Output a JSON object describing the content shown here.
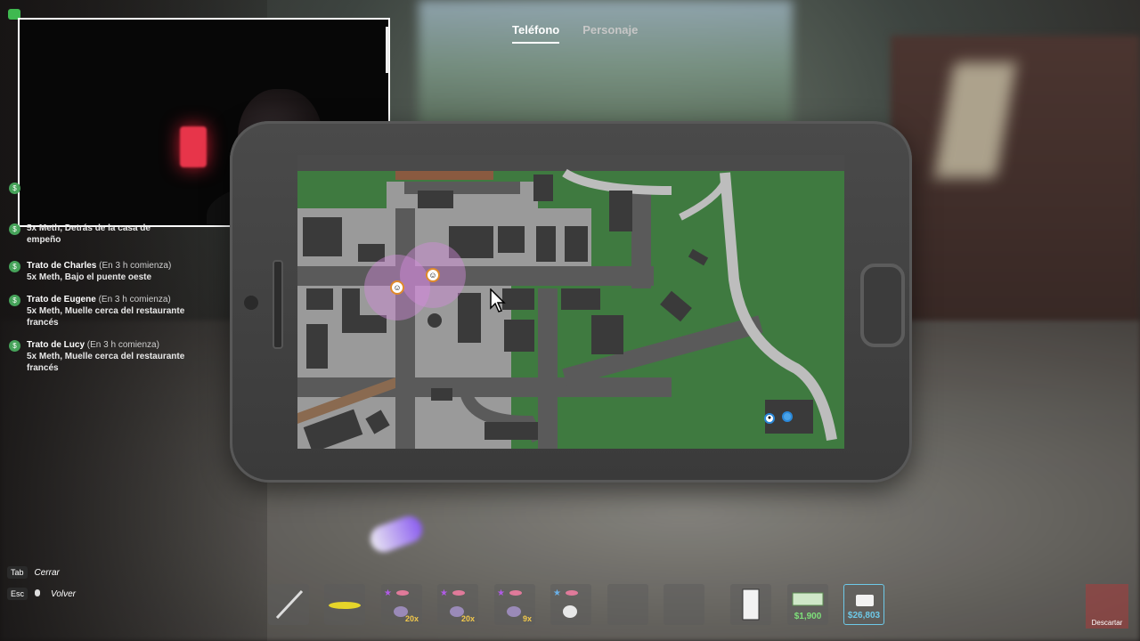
{
  "tabs": [
    {
      "label": "Teléfono",
      "active": true
    },
    {
      "label": "Personaje",
      "active": false
    }
  ],
  "deals": [
    {
      "title": "",
      "note": "",
      "desc": "5x Meth, Detrás de la casa de empeño"
    },
    {
      "title": "Trato de Charles",
      "note": "(En 3 h comienza)",
      "desc": "5x Meth, Bajo el puente oeste"
    },
    {
      "title": "Trato de Eugene",
      "note": "(En 3 h comienza)",
      "desc": "5x Meth, Muelle cerca del restaurante francés"
    },
    {
      "title": "Trato de Lucy",
      "note": "(En 3 h comienza)",
      "desc": "5x Meth, Muelle cerca del restaurante francés"
    }
  ],
  "hints": [
    {
      "key": "Tab",
      "label": "Cerrar"
    },
    {
      "key": "Esc",
      "label": "Volver"
    }
  ],
  "hotbar": {
    "qty_1": "20x",
    "qty_2": "20x",
    "qty_3": "9x",
    "cash": "$1,900",
    "bank": "$26,803",
    "discard": "Descartar"
  },
  "colors": {
    "cash": "#7ee07a",
    "bank": "#6ec9e8",
    "deal_icon": "#46a35a",
    "map_grass": "#3f7a40",
    "map_road": "#5a5a5a"
  }
}
